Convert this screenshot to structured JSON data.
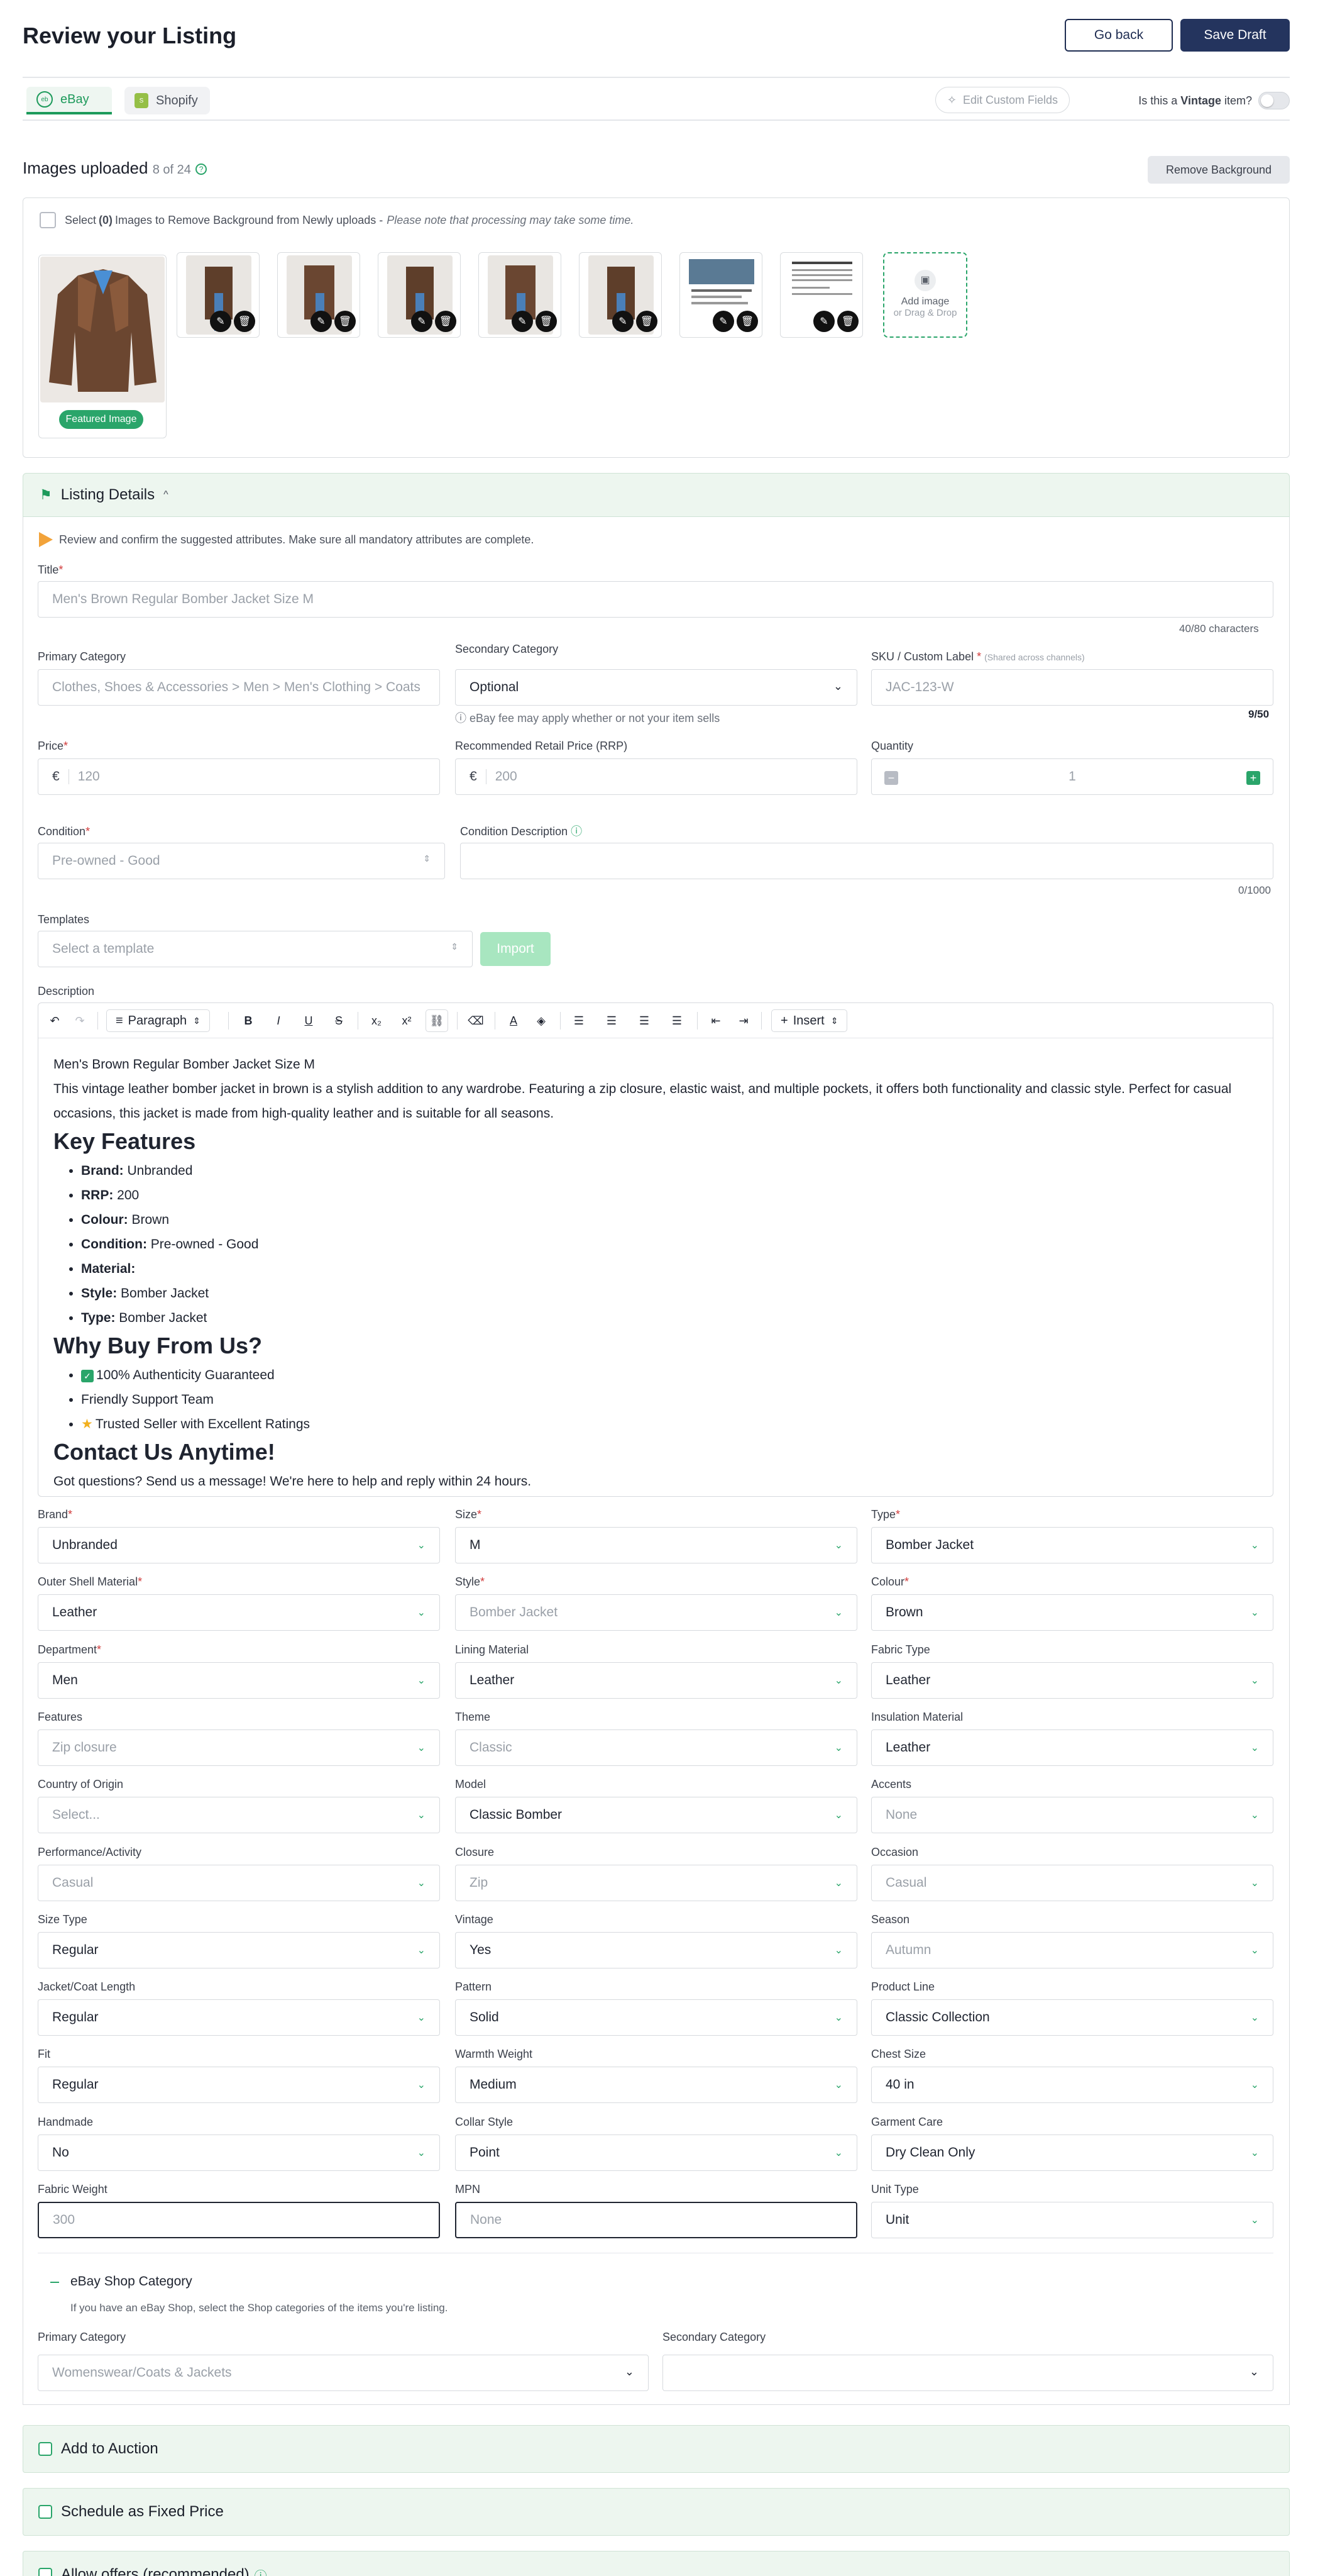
{
  "header": {
    "title": "Review your Listing",
    "go_back": "Go back",
    "save_draft": "Save Draft"
  },
  "tabs": [
    {
      "label": "eBay",
      "active": true
    },
    {
      "label": "Shopify",
      "active": false
    }
  ],
  "tabs_right": {
    "edit_custom_fields": "Edit Custom Fields",
    "vintage_question_prefix": "Is this a ",
    "vintage_word": "Vintage",
    "vintage_question_suffix": " item?",
    "vintage_on": false
  },
  "images": {
    "title": "Images uploaded",
    "count": "8 of 24",
    "remove_background": "Remove Background",
    "select_prefix": "Select ",
    "select_count": "(0)",
    "select_text": " Images to Remove Background from Newly uploads - ",
    "select_note": "Please note that processing may take some time.",
    "featured": "Featured Image",
    "add_image": "Add image",
    "drag_drop": "or Drag & Drop"
  },
  "listing_details": {
    "title": "Listing Details",
    "hint": "Review and confirm the suggested attributes. Make sure all mandatory attributes are complete.",
    "title_label": "Title",
    "title_value": "Men's Brown Regular Bomber Jacket Size M",
    "title_counter": "40/80 characters",
    "primary_category_label": "Primary Category",
    "primary_category_value": "Clothes, Shoes & Accessories > Men > Men's Clothing > Coats",
    "secondary_category_label": "Secondary Category",
    "secondary_category_value": "Optional",
    "fee_note": "eBay fee may apply whether or not your item sells",
    "sku_label": "SKU / Custom Label",
    "sku_note": "(Shared across channels)",
    "sku_placeholder": "JAC-123-W",
    "sku_counter": "9/50",
    "price_label": "Price",
    "price_value": "120",
    "rrp_label": "Recommended Retail Price (RRP)",
    "rrp_value": "200",
    "currency": "€",
    "quantity_label": "Quantity",
    "quantity_value": "1",
    "condition_label": "Condition",
    "condition_value": "Pre-owned - Good",
    "condition_desc_label": "Condition Description",
    "condition_counter": "0/1000",
    "templates_label": "Templates",
    "templates_placeholder": "Select a template",
    "import": "Import",
    "description_label": "Description"
  },
  "toolbar": {
    "paragraph": "Paragraph",
    "insert": "Insert"
  },
  "description": {
    "line1": "Men's Brown Regular Bomber Jacket Size M",
    "para": "This vintage leather bomber jacket in brown is a stylish addition to any wardrobe. Featuring a zip closure, elastic waist, and multiple pockets, it offers both functionality and classic style. Perfect for casual occasions, this jacket is made from high-quality leather and is suitable for all seasons.",
    "h_features": "Key Features",
    "features": [
      {
        "k": "Brand:",
        "v": " Unbranded"
      },
      {
        "k": "RRP:",
        "v": " 200"
      },
      {
        "k": "Colour:",
        "v": " Brown"
      },
      {
        "k": "Condition:",
        "v": " Pre-owned - Good"
      },
      {
        "k": "Material:",
        "v": ""
      },
      {
        "k": "Style:",
        "v": " Bomber Jacket"
      },
      {
        "k": "Type:",
        "v": " Bomber Jacket"
      }
    ],
    "h_why": "Why Buy From Us?",
    "why": [
      "100% Authenticity Guaranteed",
      "Friendly Support Team",
      "Trusted Seller with Excellent Ratings"
    ],
    "h_contact": "Contact Us Anytime!",
    "contact": "Got questions? Send us a message! We're here to help and reply within 24 hours."
  },
  "attributes": [
    {
      "label": "Brand",
      "required": true,
      "value": "Unbranded",
      "muted": false
    },
    {
      "label": "Size",
      "required": true,
      "value": "M",
      "muted": false
    },
    {
      "label": "Type",
      "required": true,
      "value": "Bomber Jacket",
      "muted": false
    },
    {
      "label": "Outer Shell Material",
      "required": true,
      "value": "Leather",
      "muted": false
    },
    {
      "label": "Style",
      "required": true,
      "value": "Bomber Jacket",
      "muted": true
    },
    {
      "label": "Colour",
      "required": true,
      "value": "Brown",
      "muted": false
    },
    {
      "label": "Department",
      "required": true,
      "value": "Men",
      "muted": false
    },
    {
      "label": "Lining Material",
      "required": false,
      "value": "Leather",
      "muted": false
    },
    {
      "label": "Fabric Type",
      "required": false,
      "value": "Leather",
      "muted": false
    },
    {
      "label": "Features",
      "required": false,
      "value": "Zip closure",
      "muted": true
    },
    {
      "label": "Theme",
      "required": false,
      "value": "Classic",
      "muted": true
    },
    {
      "label": "Insulation Material",
      "required": false,
      "value": "Leather",
      "muted": false
    },
    {
      "label": "Country of Origin",
      "required": false,
      "value": "Select...",
      "muted": true
    },
    {
      "label": "Model",
      "required": false,
      "value": "Classic Bomber",
      "muted": false
    },
    {
      "label": "Accents",
      "required": false,
      "value": "None",
      "muted": true
    },
    {
      "label": "Performance/Activity",
      "required": false,
      "value": "Casual",
      "muted": true
    },
    {
      "label": "Closure",
      "required": false,
      "value": "Zip",
      "muted": true
    },
    {
      "label": "Occasion",
      "required": false,
      "value": "Casual",
      "muted": true
    },
    {
      "label": "Size Type",
      "required": false,
      "value": "Regular",
      "muted": false
    },
    {
      "label": "Vintage",
      "required": false,
      "value": "Yes",
      "muted": false
    },
    {
      "label": "Season",
      "required": false,
      "value": "Autumn",
      "muted": true
    },
    {
      "label": "Jacket/Coat Length",
      "required": false,
      "value": "Regular",
      "muted": false
    },
    {
      "label": "Pattern",
      "required": false,
      "value": "Solid",
      "muted": false
    },
    {
      "label": "Product Line",
      "required": false,
      "value": "Classic Collection",
      "muted": false
    },
    {
      "label": "Fit",
      "required": false,
      "value": "Regular",
      "muted": false
    },
    {
      "label": "Warmth Weight",
      "required": false,
      "value": "Medium",
      "muted": false
    },
    {
      "label": "Chest Size",
      "required": false,
      "value": "40 in",
      "muted": false
    },
    {
      "label": "Handmade",
      "required": false,
      "value": "No",
      "muted": false
    },
    {
      "label": "Collar Style",
      "required": false,
      "value": "Point",
      "muted": false
    },
    {
      "label": "Garment Care",
      "required": false,
      "value": "Dry Clean Only",
      "muted": false
    },
    {
      "label": "Fabric Weight",
      "required": false,
      "value": "300",
      "muted": true
    },
    {
      "label": "MPN",
      "required": false,
      "value": "None",
      "muted": true
    },
    {
      "label": "Unit Type",
      "required": false,
      "value": "Unit",
      "muted": false
    }
  ],
  "shop": {
    "title": "eBay Shop Category",
    "note": "If you have an eBay Shop, select the Shop categories of the items you're listing.",
    "primary_label": "Primary Category",
    "primary_value": "Womenswear/Coats & Jackets",
    "secondary_label": "Secondary Category",
    "secondary_value": ""
  },
  "bottom": {
    "auction": "Add to Auction",
    "schedule": "Schedule as Fixed Price",
    "offers": "Allow offers (recommended)"
  },
  "colors": {
    "accent_green": "#2aa56a",
    "navy": "#24345e",
    "required_red": "#d13b3b"
  }
}
